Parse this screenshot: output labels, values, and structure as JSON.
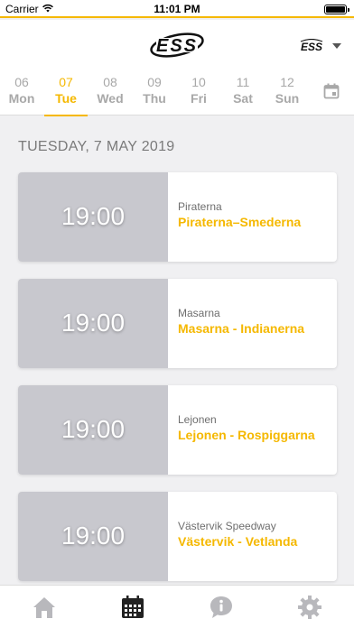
{
  "status_bar": {
    "carrier": "Carrier",
    "time": "11:01 PM"
  },
  "header": {
    "logo_text": "ESS",
    "league_text": "ESS"
  },
  "days": [
    {
      "num": "06",
      "name": "Mon",
      "active": false
    },
    {
      "num": "07",
      "name": "Tue",
      "active": true
    },
    {
      "num": "08",
      "name": "Wed",
      "active": false
    },
    {
      "num": "09",
      "name": "Thu",
      "active": false
    },
    {
      "num": "10",
      "name": "Fri",
      "active": false
    },
    {
      "num": "11",
      "name": "Sat",
      "active": false
    },
    {
      "num": "12",
      "name": "Sun",
      "active": false
    }
  ],
  "date_heading": "TUESDAY, 7 MAY 2019",
  "matches": [
    {
      "time": "19:00",
      "home": "Piraterna",
      "title": "Piraterna–Smederna"
    },
    {
      "time": "19:00",
      "home": "Masarna",
      "title": "Masarna - Indianerna"
    },
    {
      "time": "19:00",
      "home": "Lejonen",
      "title": "Lejonen - Rospiggarna"
    },
    {
      "time": "19:00",
      "home": "Västervik Speedway",
      "title": "Västervik - Vetlanda"
    }
  ],
  "colors": {
    "accent": "#f5b800",
    "time_block": "#c8c8ce",
    "background": "#f0f0f2"
  },
  "tabs": [
    {
      "icon": "home-icon",
      "active": false
    },
    {
      "icon": "calendar-icon",
      "active": true
    },
    {
      "icon": "info-icon",
      "active": false
    },
    {
      "icon": "gear-icon",
      "active": false
    }
  ]
}
